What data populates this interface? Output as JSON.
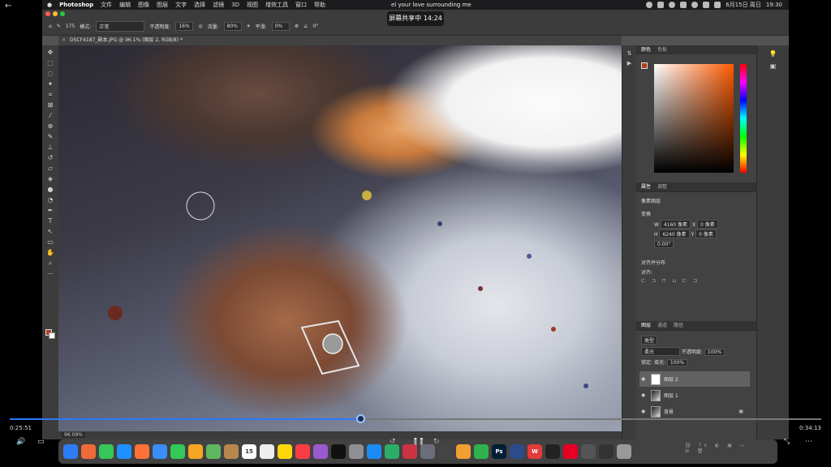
{
  "menubar": {
    "app_name": "Photoshop",
    "menus": [
      "文件",
      "编辑",
      "图像",
      "图层",
      "文字",
      "选择",
      "滤镜",
      "3D",
      "视图",
      "增效工具",
      "窗口",
      "帮助"
    ],
    "song_text": "el your love surrounding me",
    "date_text": "6月15日 周日",
    "time_text": "19:30"
  },
  "sharing_tooltip": "屏幕共享中 14:24",
  "options_bar": {
    "brush_size": "175",
    "mode_label": "模式:",
    "mode_value": "正常",
    "opacity_label": "不透明度:",
    "opacity_value": "16%",
    "flow_label": "流量:",
    "flow_value": "80%",
    "smoothing_label": "平滑:",
    "smoothing_value": "0%",
    "angle_value": "0°"
  },
  "document_tab": "DSCF4187_副本.JPG @ 96.1% (图层 2, RGB/8) *",
  "status": {
    "zoom": "96.09%"
  },
  "color_panel": {
    "tabs": [
      "颜色",
      "色板"
    ],
    "foreground": "#b2401f"
  },
  "properties_panel": {
    "tabs": [
      "属性",
      "调整"
    ],
    "pixel_layer_label": "像素图层",
    "transform_label": "变换",
    "w_label": "W",
    "w_value": "4160 像素",
    "h_label": "H",
    "h_value": "6240 像素",
    "x_label": "X",
    "x_value": "0 像素",
    "y_label": "Y",
    "y_value": "0 像素",
    "angle_value": "0.00°",
    "align_label": "对齐并分布",
    "align_sub": "对齐:"
  },
  "layers_panel": {
    "tabs": [
      "图层",
      "通道",
      "路径"
    ],
    "filter_label": "类型",
    "blend_mode": "柔光",
    "opacity_label": "不透明度:",
    "opacity_value": "100%",
    "lock_label": "锁定:",
    "fill_label": "填充:",
    "fill_value": "100%",
    "layers": [
      {
        "name": "图层 2"
      },
      {
        "name": "图层 1"
      },
      {
        "name": "背景"
      }
    ]
  },
  "video": {
    "current_time": "0:25:51",
    "total_time": "0:34:13",
    "progress": 0.432,
    "accent": "#2b78ff"
  },
  "dock": {
    "items": [
      {
        "icon": "finder-icon",
        "color": "#2d7cf6",
        "label": ""
      },
      {
        "icon": "launchpad-icon",
        "color": "#ef6a3a",
        "label": ""
      },
      {
        "icon": "messages-icon",
        "color": "#35c759",
        "label": ""
      },
      {
        "icon": "safari-icon",
        "color": "#1e90ff",
        "label": ""
      },
      {
        "icon": "firefox-icon",
        "color": "#ff7139",
        "label": ""
      },
      {
        "icon": "mail-icon",
        "color": "#3a8ef6",
        "label": ""
      },
      {
        "icon": "facetime-icon",
        "color": "#34c759",
        "label": ""
      },
      {
        "icon": "photos-icon",
        "color": "#f5a623",
        "label": ""
      },
      {
        "icon": "maps-icon",
        "color": "#5fb85f",
        "label": ""
      },
      {
        "icon": "bear-icon",
        "color": "#b7874b",
        "label": ""
      },
      {
        "icon": "calendar-icon",
        "color": "#ffffff",
        "label": "15"
      },
      {
        "icon": "reminders-icon",
        "color": "#eeeeee",
        "label": ""
      },
      {
        "icon": "notes-icon",
        "color": "#ffd60a",
        "label": ""
      },
      {
        "icon": "music-icon",
        "color": "#fc3c44",
        "label": ""
      },
      {
        "icon": "podcasts-icon",
        "color": "#9b59d0",
        "label": ""
      },
      {
        "icon": "tv-icon",
        "color": "#111111",
        "label": ""
      },
      {
        "icon": "system-settings-icon",
        "color": "#8e8e93",
        "label": ""
      },
      {
        "icon": "app-store-icon",
        "color": "#1c8cf5",
        "label": ""
      },
      {
        "icon": "wechat-icon",
        "color": "#2aae67",
        "label": ""
      },
      {
        "icon": "photo-booth-icon",
        "color": "#cc3344",
        "label": ""
      },
      {
        "icon": "preview-icon",
        "color": "#6d6d7a",
        "label": ""
      },
      {
        "icon": "iphone-mirror-icon",
        "color": "#444444",
        "label": ""
      },
      {
        "icon": "pages-icon",
        "color": "#f0a030",
        "label": ""
      },
      {
        "icon": "numbers-icon",
        "color": "#2fb24c",
        "label": ""
      },
      {
        "icon": "photoshop-icon",
        "color": "#001e36",
        "label": "Ps"
      },
      {
        "icon": "quicktime-icon",
        "color": "#2b4b8a",
        "label": ""
      },
      {
        "icon": "wps-icon",
        "color": "#e43b3b",
        "label": "W"
      },
      {
        "icon": "qq-icon",
        "color": "#222222",
        "label": ""
      },
      {
        "icon": "netease-music-icon",
        "color": "#e60026",
        "label": ""
      },
      {
        "icon": "screenshot-icon",
        "color": "#555555",
        "label": ""
      },
      {
        "icon": "keyboard-icon",
        "color": "#333333",
        "label": ""
      },
      {
        "icon": "trash-icon",
        "color": "#999999",
        "label": ""
      }
    ]
  }
}
